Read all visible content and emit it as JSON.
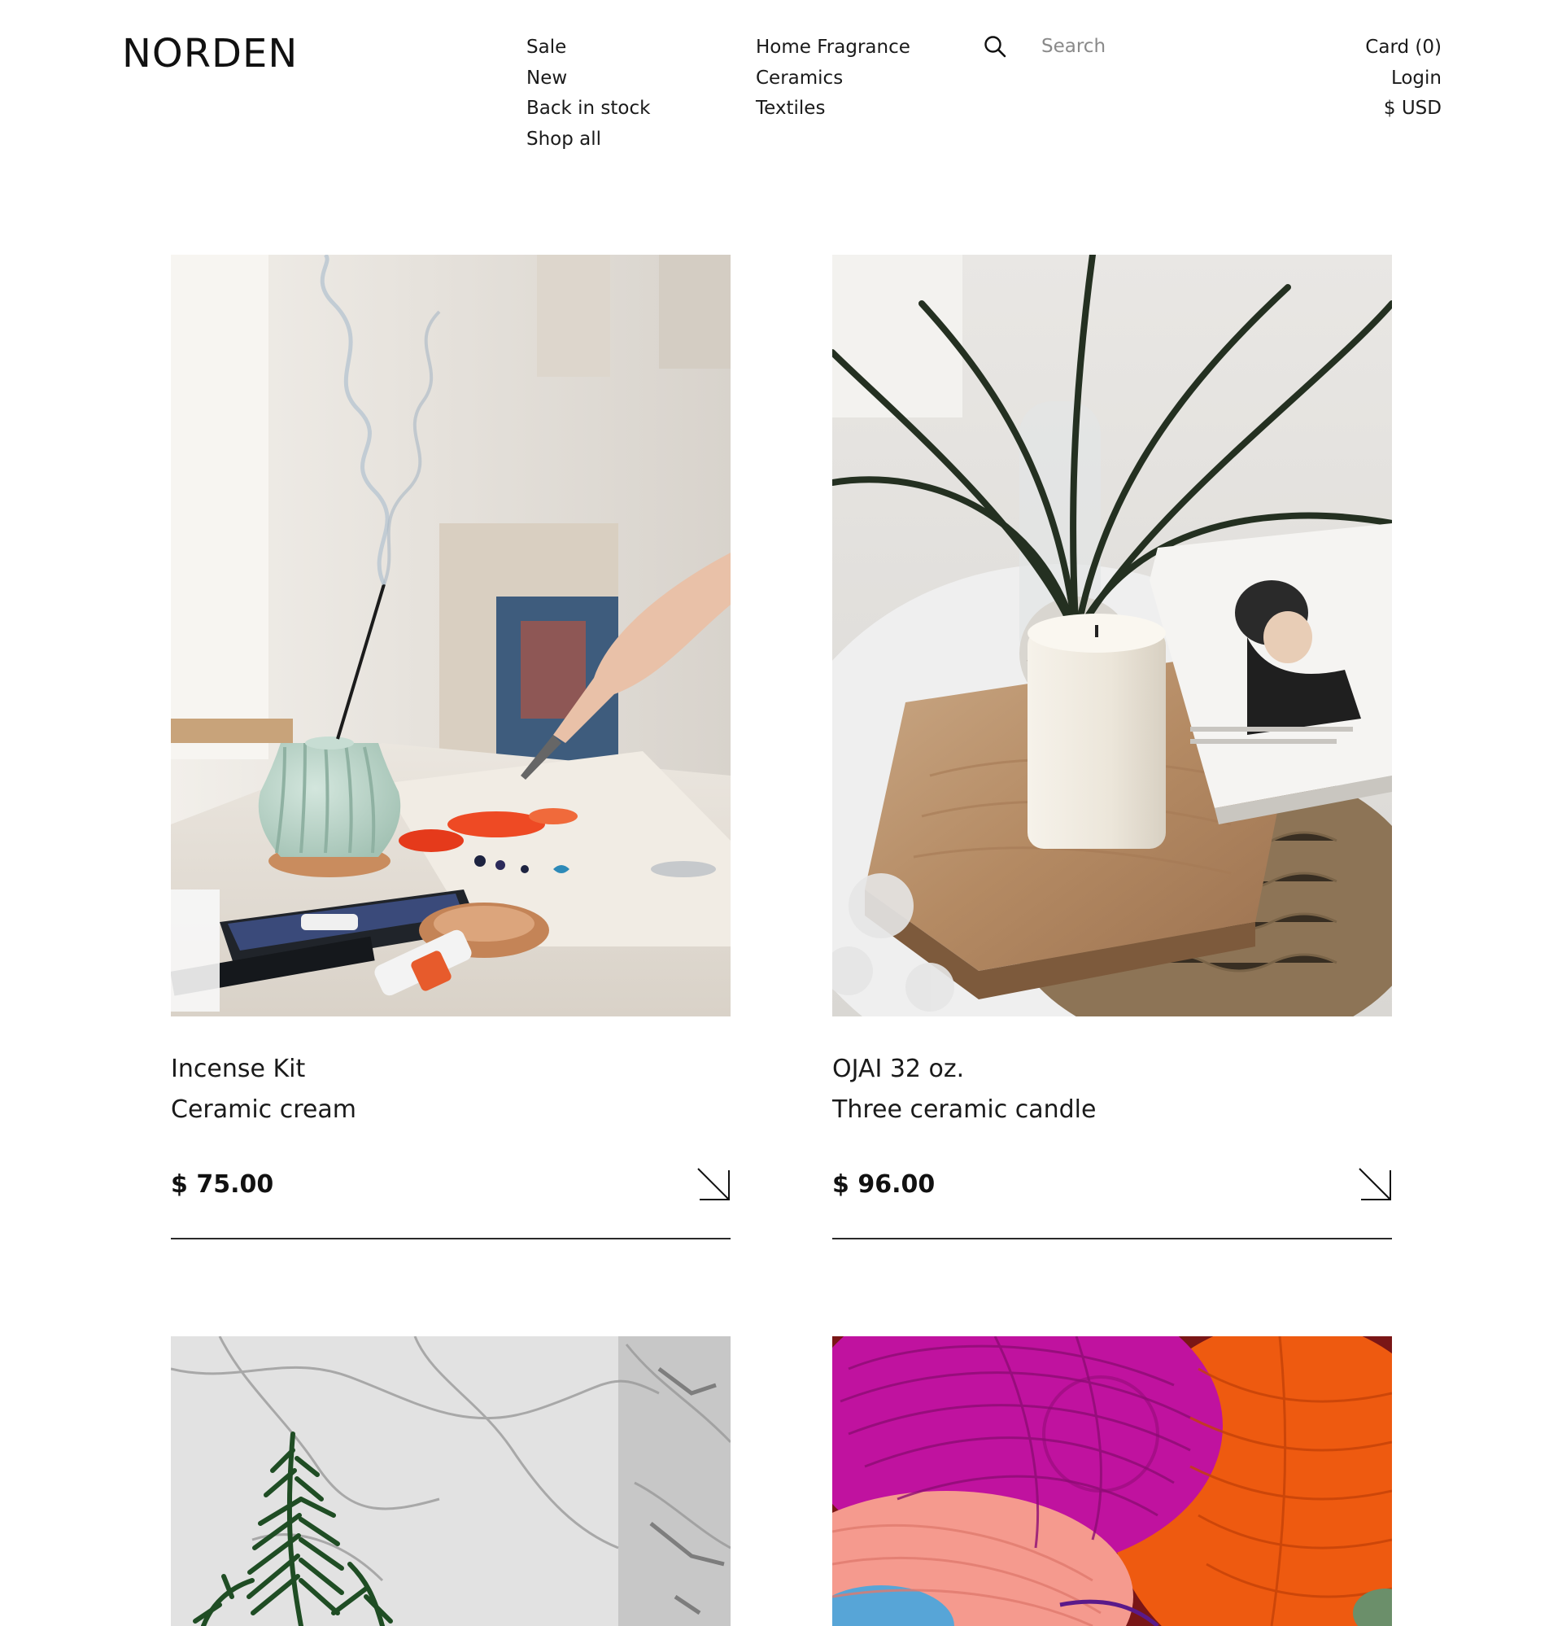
{
  "brand": {
    "logo": "NORDEN"
  },
  "nav": {
    "column1": [
      "Sale",
      "New",
      "Back in stock",
      "Shop all"
    ],
    "column2": [
      "Home Fragrance",
      "Ceramics",
      "Textiles"
    ]
  },
  "search": {
    "placeholder": "Search",
    "icon": "search-icon"
  },
  "account": {
    "cart": "Card (0)",
    "login": "Login",
    "currency": "$ USD"
  },
  "products": [
    {
      "name": "Incense Kit",
      "subtitle": "Ceramic cream",
      "price": "$ 75.00",
      "image": "incense-vase-on-painting-table"
    },
    {
      "name": "OJAI 32 oz.",
      "subtitle": "Three ceramic candle",
      "price": "$ 96.00",
      "image": "white-candle-on-wood-board"
    },
    {
      "name": "",
      "subtitle": "",
      "price": "",
      "image": "plant-against-marble-wall"
    },
    {
      "name": "",
      "subtitle": "",
      "price": "",
      "image": "colorful-yarn-balls"
    }
  ],
  "colors": {
    "text": "#1a1a1a",
    "background": "#ffffff",
    "rule": "#2a2a2a"
  }
}
